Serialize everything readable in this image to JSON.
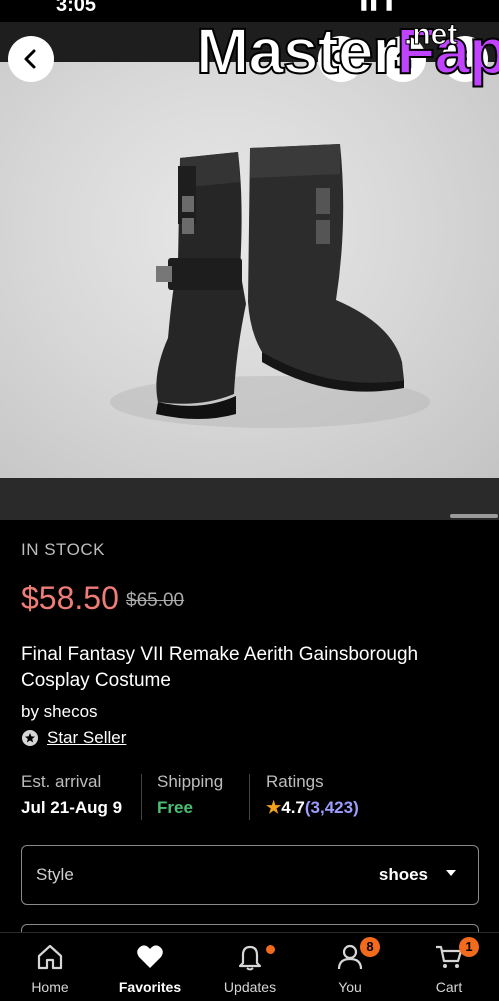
{
  "status_bar": {
    "time": "3:05"
  },
  "watermark": {
    "brand_master": "Master",
    "brand_fap": "Fap",
    "brand_net": ".net"
  },
  "product": {
    "stock": "IN STOCK",
    "price": "$58.50",
    "original_price": "$65.00",
    "title": "Final Fantasy VII Remake Aerith Gainsborough Cosplay Costume",
    "by_shop": "by shecos",
    "seller_badge": "Star Seller"
  },
  "info": {
    "arrival_label": "Est. arrival",
    "arrival_value": "Jul 21-Aug 9",
    "shipping_label": "Shipping",
    "shipping_value": "Free",
    "ratings_label": "Ratings",
    "rating_value": "4.7",
    "rating_count": "(3,423)"
  },
  "style_select": {
    "label": "Style",
    "value": "shoes"
  },
  "tabbar": {
    "tabs": [
      {
        "label": "Home",
        "icon": "home-icon"
      },
      {
        "label": "Favorites",
        "icon": "heart-icon"
      },
      {
        "label": "Updates",
        "icon": "bell-icon"
      },
      {
        "label": "You",
        "icon": "user-icon",
        "badge": "8"
      },
      {
        "label": "Cart",
        "icon": "cart-icon",
        "badge": "1"
      }
    ],
    "active": "Favorites"
  },
  "colors": {
    "price": "#ef7d77",
    "free": "#4bbf73",
    "badge": "#f26b1d",
    "link_count": "#9d9dff",
    "star": "#f2a11d"
  }
}
